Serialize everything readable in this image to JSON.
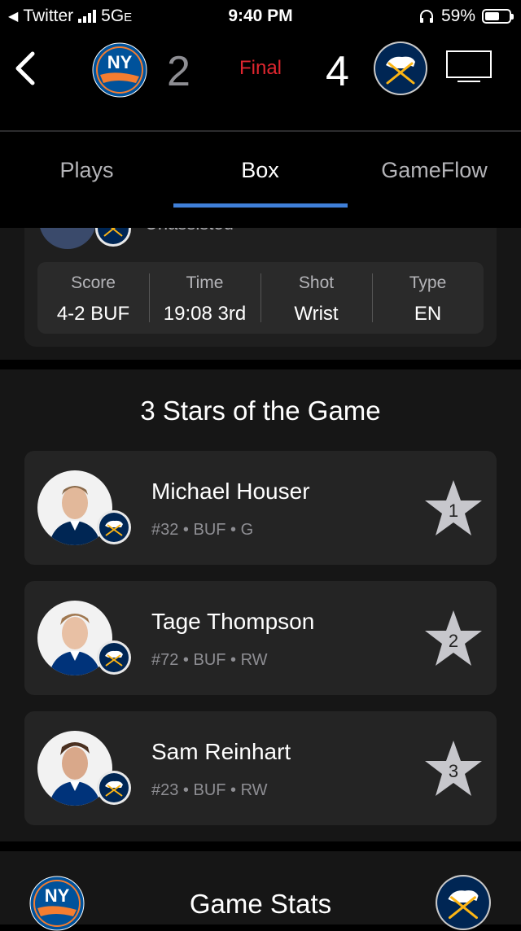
{
  "status_bar": {
    "back_app": "Twitter",
    "network": "5G",
    "network_suffix": "E",
    "time": "9:40 PM",
    "battery": "59%",
    "battery_level": 0.59,
    "signal_bars": 4
  },
  "header": {
    "away_team": "Islanders",
    "away_abbr": "NY",
    "away_score": "2",
    "home_team": "Sabres",
    "home_score": "4",
    "status": "Final"
  },
  "tabs": [
    {
      "label": "Plays",
      "active": false
    },
    {
      "label": "Box",
      "active": true
    },
    {
      "label": "GameFlow",
      "active": false
    }
  ],
  "last_goal": {
    "assist_text": "Unassisted",
    "columns": [
      {
        "header": "Score",
        "value": "4-2 BUF"
      },
      {
        "header": "Time",
        "value": "19:08 3rd"
      },
      {
        "header": "Shot",
        "value": "Wrist"
      },
      {
        "header": "Type",
        "value": "EN"
      }
    ]
  },
  "three_stars": {
    "title": "3 Stars of the Game",
    "players": [
      {
        "name": "Michael Houser",
        "info": "#32 • BUF • G",
        "rank": "1"
      },
      {
        "name": "Tage Thompson",
        "info": "#72 • BUF • RW",
        "rank": "2"
      },
      {
        "name": "Sam Reinhart",
        "info": "#23 • BUF • RW",
        "rank": "3"
      }
    ]
  },
  "game_stats": {
    "title": "Game Stats"
  },
  "colors": {
    "accent_tab": "#3f7fd8",
    "final_red": "#e0262f",
    "islanders_blue": "#00529b",
    "islanders_orange": "#f47d30",
    "sabres_navy": "#002654",
    "sabres_gold": "#fcb514"
  }
}
